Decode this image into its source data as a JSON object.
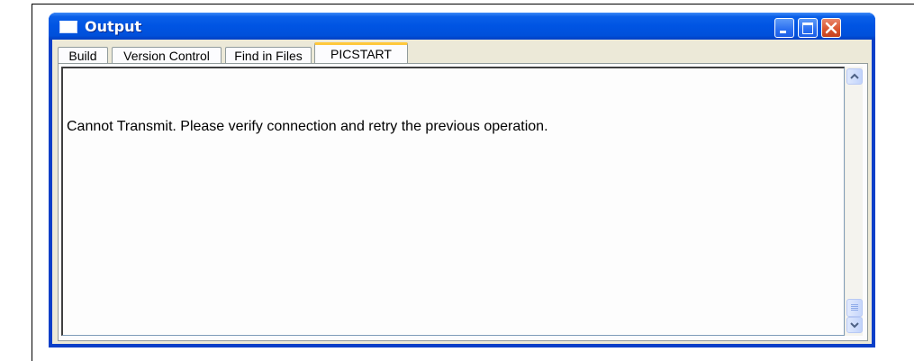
{
  "window": {
    "title": "Output"
  },
  "tabs": [
    {
      "label": "Build"
    },
    {
      "label": "Version Control"
    },
    {
      "label": "Find in Files"
    },
    {
      "label": "PICSTART",
      "active": true
    }
  ],
  "output": {
    "message": "Cannot Transmit. Please verify connection and retry the previous operation."
  },
  "icons": {
    "app": "window-icon",
    "minimize": "minimize-icon",
    "maximize": "maximize-icon",
    "close": "close-icon",
    "scroll_up": "chevron-up-icon",
    "scroll_down": "chevron-down-icon"
  },
  "colors": {
    "titlebar": "#0054e3",
    "active_tab_accent": "#ffc83c",
    "close_button": "#d9532c"
  }
}
